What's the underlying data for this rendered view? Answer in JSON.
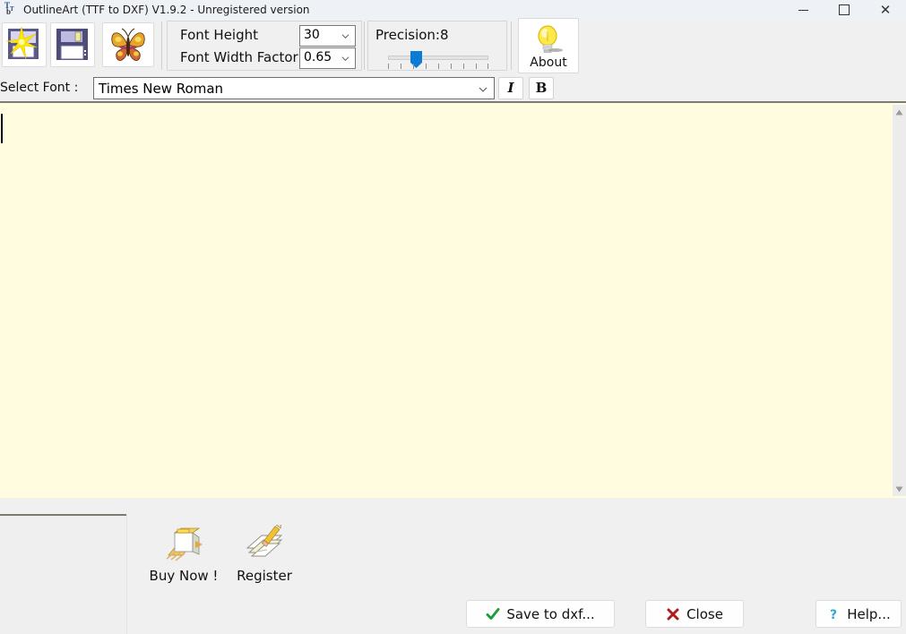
{
  "window": {
    "title": "OutlineArt (TTF to DXF) V1.9.2 - Unregistered version",
    "icon": "ttf-document-icon",
    "controls": {
      "minimize": "minimize-icon",
      "maximize": "maximize-icon",
      "close": "close-icon"
    }
  },
  "toolbar": {
    "new_button": "new-file-icon",
    "save_button": "save-floppy-icon",
    "butterfly_button": "butterfly-icon",
    "font_height": {
      "label": "Font Height",
      "value": "30"
    },
    "font_width_factor": {
      "label": "Font Width Factor",
      "value": "0.65"
    },
    "precision": {
      "label": "Precision:8",
      "value": 8,
      "min": 1,
      "max": 9,
      "ticks": 9
    },
    "about": {
      "label": "About",
      "icon": "lightbulb-icon"
    }
  },
  "font_row": {
    "select_font_label": "Select Font :",
    "selected_font": "Times New Roman",
    "italic_label": "I",
    "bold_label": "B"
  },
  "editor": {
    "text": "",
    "bg_color": "#fffce0"
  },
  "promo": [
    {
      "label": "Buy Now !",
      "icon": "buy-now-icon"
    },
    {
      "label": "Register",
      "icon": "register-pencil-icon"
    }
  ],
  "actions": [
    {
      "label": "Save to dxf...",
      "icon": "check-icon",
      "color": "#1e9c3c"
    },
    {
      "label": "Close",
      "icon": "cross-icon",
      "color": "#b01a1a"
    },
    {
      "label": "Help...",
      "icon": "question-icon",
      "color": "#2fa8d8"
    }
  ],
  "colors": {
    "titlebar": "#eef1f6",
    "chrome": "#f0f0f0",
    "editor": "#fffce0",
    "slider_accent": "#0a7cd6"
  }
}
